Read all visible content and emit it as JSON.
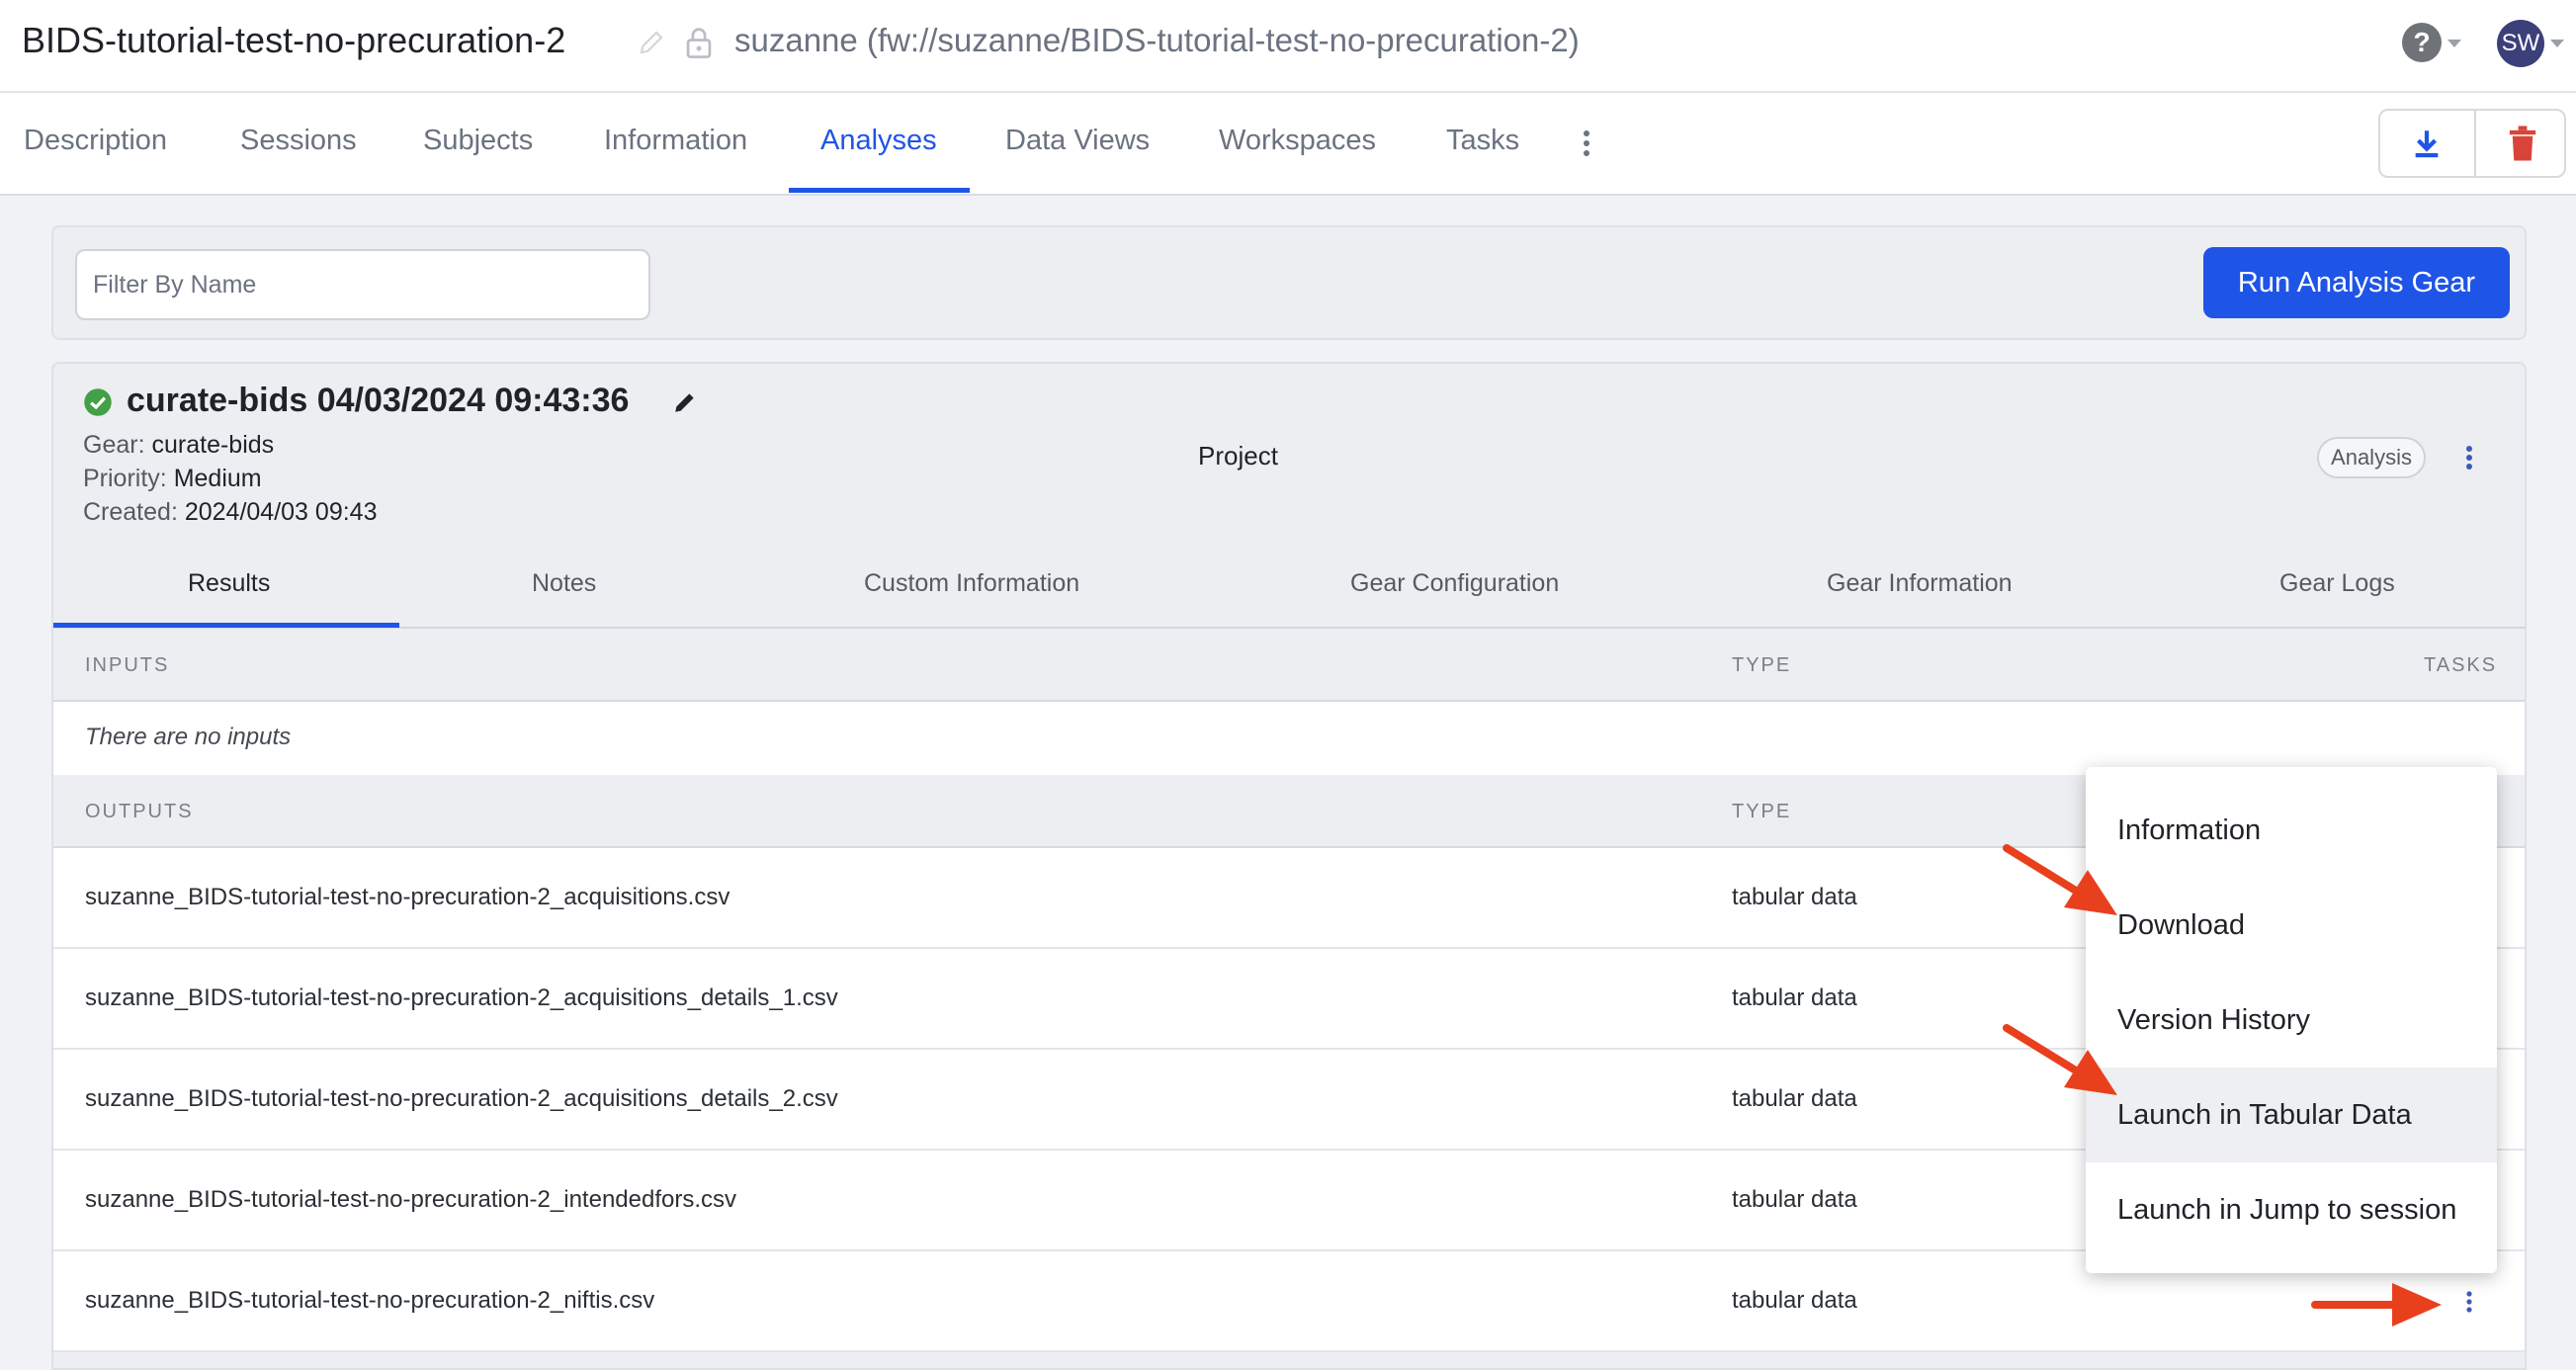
{
  "header": {
    "project_title": "BIDS-tutorial-test-no-precuration-2",
    "project_path": "suzanne (fw://suzanne/BIDS-tutorial-test-no-precuration-2)",
    "help_glyph": "?",
    "user_initials": "SW"
  },
  "nav": {
    "tabs": [
      {
        "label": "Description"
      },
      {
        "label": "Sessions"
      },
      {
        "label": "Subjects"
      },
      {
        "label": "Information"
      },
      {
        "label": "Analyses",
        "active": true
      },
      {
        "label": "Data Views"
      },
      {
        "label": "Workspaces"
      },
      {
        "label": "Tasks"
      }
    ]
  },
  "filter": {
    "placeholder": "Filter By Name",
    "value": ""
  },
  "run_button": {
    "label": "Run Analysis Gear"
  },
  "analysis": {
    "title": "curate-bids 04/03/2024 09:43:36",
    "gear_label": "Gear:",
    "gear_value": "curate-bids",
    "priority_label": "Priority:",
    "priority_value": "Medium",
    "created_label": "Created:",
    "created_value": "2024/04/03 09:43",
    "parent": "Project",
    "badge": "Analysis",
    "tabs": [
      "Results",
      "Notes",
      "Custom Information",
      "Gear Configuration",
      "Gear Information",
      "Gear Logs"
    ],
    "inputs_header": "INPUTS",
    "type_header": "TYPE",
    "tasks_header": "TASKS",
    "no_inputs": "There are no inputs",
    "outputs_header": "OUTPUTS",
    "outputs": [
      {
        "name": "suzanne_BIDS-tutorial-test-no-precuration-2_acquisitions.csv",
        "type": "tabular data"
      },
      {
        "name": "suzanne_BIDS-tutorial-test-no-precuration-2_acquisitions_details_1.csv",
        "type": "tabular data"
      },
      {
        "name": "suzanne_BIDS-tutorial-test-no-precuration-2_acquisitions_details_2.csv",
        "type": "tabular data"
      },
      {
        "name": "suzanne_BIDS-tutorial-test-no-precuration-2_intendedfors.csv",
        "type": "tabular data"
      },
      {
        "name": "suzanne_BIDS-tutorial-test-no-precuration-2_niftis.csv",
        "type": "tabular data"
      }
    ]
  },
  "context_menu": {
    "items": [
      "Information",
      "Download",
      "Version History",
      "Launch in Tabular Data",
      "Launch in Jump to session"
    ],
    "hovered_index": 3
  },
  "colors": {
    "accent": "#1f55e6",
    "success": "#43a047",
    "danger": "#d9443a",
    "annotation_arrow": "#e8401c"
  },
  "icons": [
    "edit-pencil-icon",
    "lock-icon",
    "help-icon",
    "download-icon",
    "trash-icon",
    "check-circle-icon",
    "kebab-menu-icon",
    "annotation-arrow"
  ]
}
